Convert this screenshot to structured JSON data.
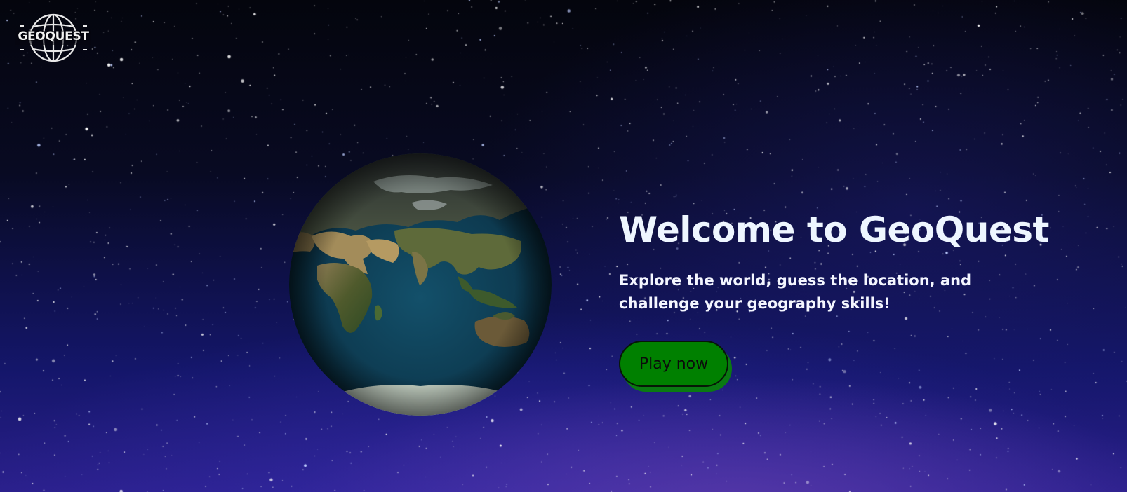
{
  "brand": {
    "logo_text": "GEOQUEST",
    "logo_icon": "globe-icon"
  },
  "globe": {
    "icon": "earth-globe-image",
    "ocean_color": "#0f4a63"
  },
  "hero": {
    "title": "Welcome to GeoQuest",
    "subtitle": "Explore the world, guess the location, and challenge your geography skills!",
    "cta_label": "Play now"
  },
  "colors": {
    "text_primary": "#eef6ff",
    "cta_background": "#008000",
    "cta_shadow": "#0a7a12",
    "sky_top": "#04050d",
    "sky_bottom": "#2a1f8a"
  }
}
